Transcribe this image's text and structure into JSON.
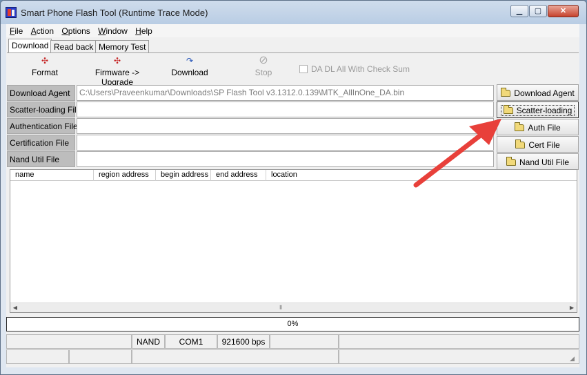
{
  "window": {
    "title": "Smart Phone Flash Tool (Runtime Trace Mode)"
  },
  "caption_buttons": {
    "minimize": "▁",
    "maximize": "▢",
    "close": "✕"
  },
  "menu": [
    "File",
    "Action",
    "Options",
    "Window",
    "Help"
  ],
  "menu_mnemonics": [
    "F",
    "A",
    "O",
    "W",
    "H"
  ],
  "tabs": [
    "Download",
    "Read back",
    "Memory Test"
  ],
  "toolbar": {
    "format": "Format",
    "firmware_upgrade": "Firmware -> Upgrade",
    "download": "Download",
    "stop": "Stop",
    "checksum": "DA DL All With Check Sum"
  },
  "fields": [
    {
      "label": "Download Agent",
      "value": "C:\\Users\\Praveenkumar\\Downloads\\SP Flash Tool v3.1312.0.139\\MTK_AllInOne_DA.bin",
      "button": "Download Agent"
    },
    {
      "label": "Scatter-loading File",
      "value": "",
      "button": "Scatter-loading"
    },
    {
      "label": "Authentication File",
      "value": "",
      "button": "Auth File"
    },
    {
      "label": "Certification File",
      "value": "",
      "button": "Cert File"
    },
    {
      "label": "Nand Util File",
      "value": "",
      "button": "Nand Util File"
    }
  ],
  "table": {
    "columns": [
      "name",
      "region address",
      "begin address",
      "end address",
      "location"
    ],
    "rows": []
  },
  "progress": {
    "text": "0%",
    "value": 0
  },
  "status": {
    "storage": "NAND",
    "port": "COM1",
    "baud": "921600 bps"
  },
  "icons": {
    "format": "multicolor-gear-icon",
    "firmware": "multicolor-gear-icon",
    "download": "refresh-arrow-icon",
    "stop": "stop-icon",
    "file_buttons": "folder-icon"
  },
  "colors": {
    "annotation_arrow": "#e8403a",
    "titlebar": "#c4d5ea"
  }
}
